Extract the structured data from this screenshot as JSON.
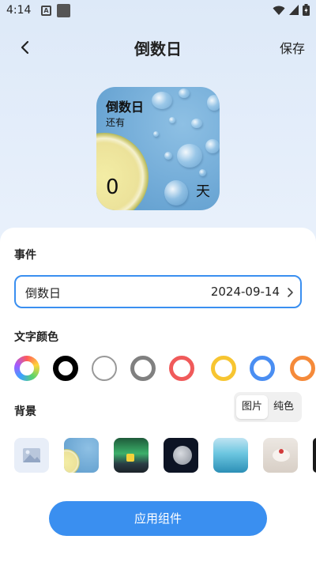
{
  "status_bar": {
    "time": "4:14"
  },
  "header": {
    "title": "倒数日",
    "save_label": "保存"
  },
  "widget_preview": {
    "title": "倒数日",
    "subtitle": "还有",
    "count": "0",
    "unit": "天"
  },
  "event_section": {
    "label": "事件",
    "event_name": "倒数日",
    "event_date": "2024-09-14"
  },
  "text_color_section": {
    "label": "文字颜色",
    "swatches": [
      {
        "name": "rainbow",
        "color": "conic"
      },
      {
        "name": "black",
        "color": "#000000",
        "selected": true
      },
      {
        "name": "white",
        "color": "#ffffff"
      },
      {
        "name": "gray",
        "color": "#808080"
      },
      {
        "name": "red",
        "color": "#f05a5a"
      },
      {
        "name": "yellow",
        "color": "#f7c531"
      },
      {
        "name": "blue",
        "color": "#4a8ef2"
      },
      {
        "name": "orange",
        "color": "#f58a3a"
      }
    ]
  },
  "background_section": {
    "label": "背景",
    "toggle": {
      "image_label": "图片",
      "solid_label": "纯色",
      "active": "image"
    },
    "thumbnails": [
      "add-image",
      "lemon-water",
      "green-aurora",
      "moon",
      "ocean",
      "cake",
      "dark"
    ]
  },
  "apply_button_label": "应用组件",
  "colors": {
    "accent": "#3a8ff0"
  }
}
